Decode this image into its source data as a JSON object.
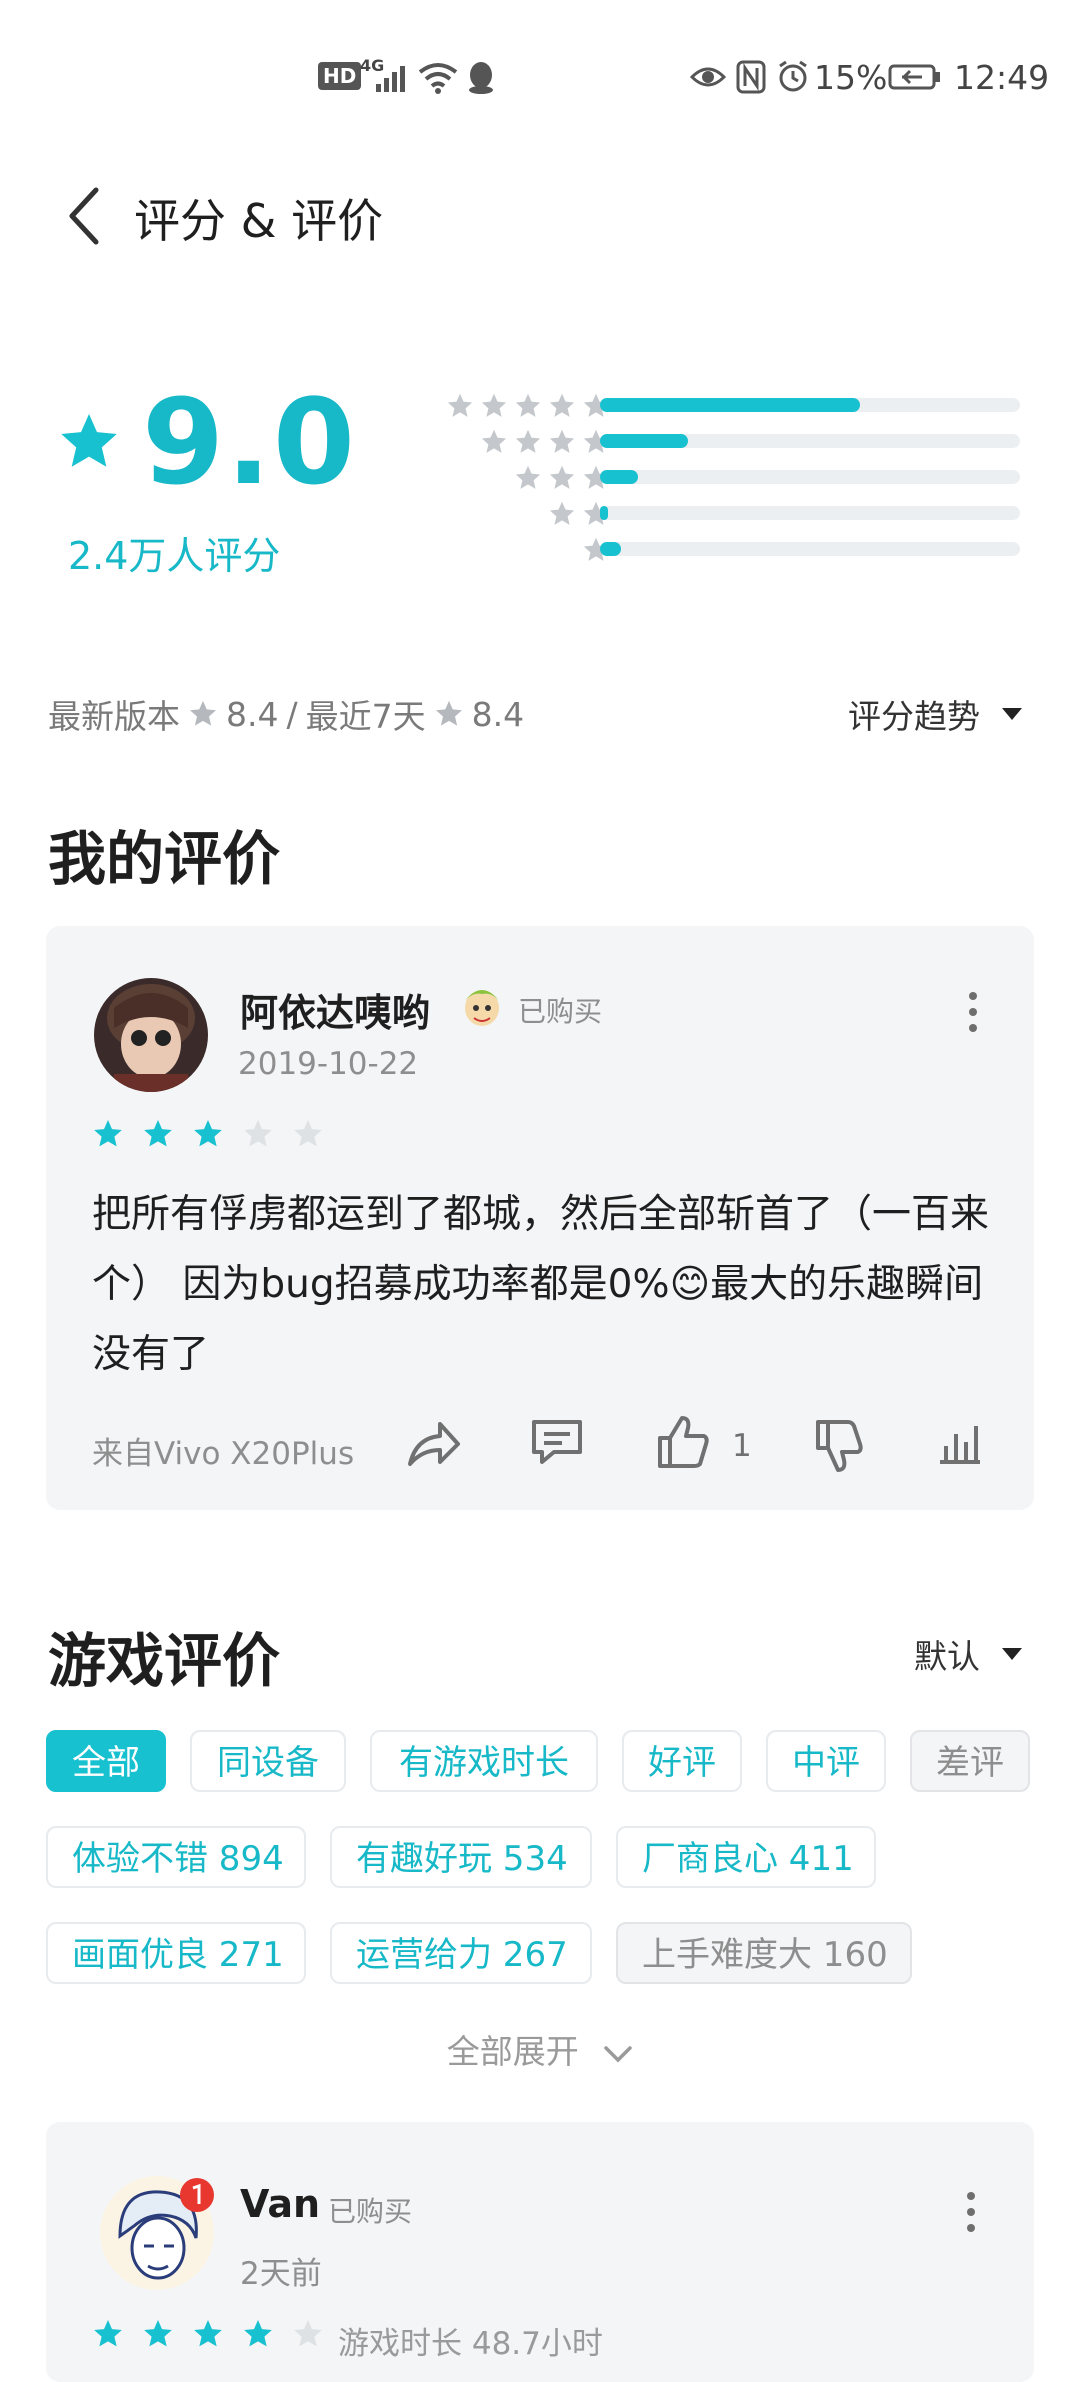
{
  "status_bar": {
    "hd": "HD",
    "net": "4G",
    "battery_pct": "15%",
    "time": "12:49"
  },
  "header": {
    "title": "评分 & 评价"
  },
  "summary": {
    "score": "9.0",
    "count_text": "2.4万人评分",
    "distribution": [
      {
        "stars": 5,
        "fraction": 0.62
      },
      {
        "stars": 4,
        "fraction": 0.21
      },
      {
        "stars": 3,
        "fraction": 0.09
      },
      {
        "stars": 2,
        "fraction": 0.02
      },
      {
        "stars": 1,
        "fraction": 0.05
      }
    ],
    "latest_version_label": "最新版本",
    "latest_version_score": "8.4",
    "separator": "/",
    "recent_label": "最近7天",
    "recent_score": "8.4",
    "trend_label": "评分趋势"
  },
  "my_review": {
    "section_title": "我的评价",
    "user": "阿依达咦哟",
    "bought": "已购买",
    "date": "2019-10-22",
    "rating": 3,
    "text": "把所有俘虏都运到了都城，然后全部斩首了（一百来个） 因为bug招募成功率都是0%😊最大的乐趣瞬间没有了",
    "device": "来自Vivo X20Plus",
    "like_count": "1"
  },
  "game_reviews": {
    "section_title": "游戏评价",
    "sort_label": "默认",
    "filters": [
      {
        "label": "全部",
        "style": "active"
      },
      {
        "label": "同设备",
        "style": "normal"
      },
      {
        "label": "有游戏时长",
        "style": "normal"
      },
      {
        "label": "好评",
        "style": "normal"
      },
      {
        "label": "中评",
        "style": "normal"
      },
      {
        "label": "差评",
        "style": "grey"
      }
    ],
    "tags": [
      {
        "label": "体验不错 894",
        "style": "normal"
      },
      {
        "label": "有趣好玩 534",
        "style": "normal"
      },
      {
        "label": "厂商良心 411",
        "style": "normal"
      },
      {
        "label": "画面优良 271",
        "style": "normal"
      },
      {
        "label": "运营给力 267",
        "style": "normal"
      },
      {
        "label": "上手难度大 160",
        "style": "grey"
      }
    ],
    "expand_label": "全部展开",
    "review": {
      "user": "Van",
      "bought": "已购买",
      "date": "2天前",
      "rating": 4,
      "play_time": "游戏时长 48.7小时"
    }
  },
  "colors": {
    "accent": "#17c1cf",
    "accent_text": "#17b8c7",
    "star_grey": "#c4c8cc",
    "card_bg": "#f4f5f7"
  }
}
